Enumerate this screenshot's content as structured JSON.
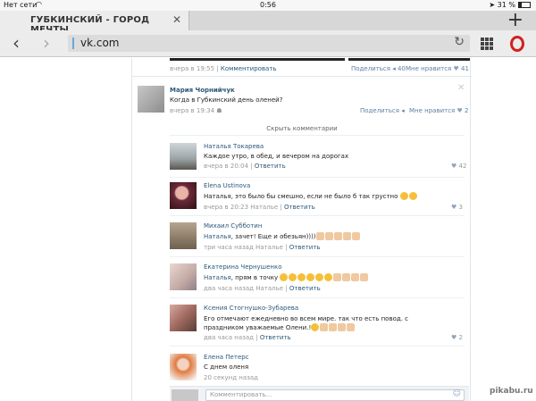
{
  "status": {
    "carrier": "Нет сети",
    "wifi_icon": "wifi-icon",
    "time": "0:56",
    "battery": "31 %"
  },
  "tab": {
    "title": "ГУБКИНСКИЙ - ГОРОД МЕЧТЫ",
    "close": "✕",
    "new_tab": "+"
  },
  "toolbar": {
    "back": "‹",
    "forward": "›",
    "url": "vk.com",
    "reload": "↻"
  },
  "post": {
    "time": "вчера в 19:55",
    "comment_link": "Комментировать",
    "share_label": "Поделиться",
    "share_count": "40",
    "like_label": "Мне нравится",
    "like_count": "41"
  },
  "top_comment": {
    "author": "Мария Чорнийчук",
    "text": "Когда в Губкинский день оленей?",
    "time": "вчера в 19:34",
    "share_label": "Поделиться",
    "like_label": "Мне нравится",
    "like_count": "2"
  },
  "hide_comments": "Скрыть комментарии",
  "replies": [
    {
      "author": "Наталья Токарева",
      "text": "Каждое утро, в обед, и вечером на дорогах",
      "time": "вчера в 20:04",
      "reply_to": "",
      "action": "Ответить",
      "likes": "42"
    },
    {
      "author": "Elena Ustinova",
      "text": "Наталья, это было бы смешно, если не было б так грустно",
      "time": "вчера в 20:23",
      "reply_to": "Наталье",
      "action": "Ответить",
      "likes": "3"
    },
    {
      "author": "Михаил Субботин",
      "text_prefix": "Наталья",
      "text": ", зачет! Еще и обезьян))))",
      "time": "три часа назад",
      "reply_to": "Наталье",
      "action": "Ответить",
      "likes": ""
    },
    {
      "author": "Екатерина Чернушенко",
      "text_prefix": "Наталья",
      "text": ", прям в точку",
      "time": "два часа назад",
      "reply_to": "Наталье",
      "action": "Ответить",
      "likes": ""
    },
    {
      "author": "Ксения Стогнушко-Зубарева",
      "text": "Его отмечают ежедневно во всем мире. так что есть повод. с праздником уважаемые Олени.!",
      "time": "два часа назад",
      "reply_to": "",
      "action": "Ответить",
      "likes": "2"
    },
    {
      "author": "Елена Петерс",
      "text": "С днем оленя",
      "time": "20 секунд назад",
      "reply_to": "",
      "action": "",
      "likes": ""
    }
  ],
  "comment_input": {
    "placeholder": "Комментировать..."
  },
  "watermark": "pikabu.ru"
}
